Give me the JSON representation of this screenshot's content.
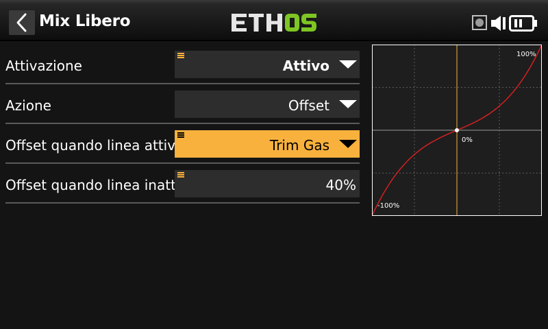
{
  "header": {
    "title": "Mix Libero",
    "logo_text": "ETHOS",
    "logo_colors": {
      "eth": "#e6e6e6",
      "os": "#7ec623"
    },
    "status_icons": [
      "record-indicator-icon",
      "speaker-icon",
      "battery-icon"
    ]
  },
  "rows": [
    {
      "label": "Attivazione",
      "value": "Attivo",
      "has_dropdown": true,
      "selected": false
    },
    {
      "label": "Azione",
      "value": "Offset",
      "has_dropdown": true,
      "selected": false
    },
    {
      "label": "Offset quando linea attiva",
      "value": "Trim Gas",
      "has_dropdown": true,
      "selected": true
    },
    {
      "label": "Offset quando linea inattiva",
      "value": "40%",
      "has_dropdown": false,
      "selected": false
    }
  ],
  "graph": {
    "label_max": "100%",
    "label_center": "0%",
    "label_min": "-100%",
    "colors": {
      "curve": "#d42020",
      "cursor": "#f9b13d",
      "grid": "#5c5c5c",
      "axis": "#9a9a9a",
      "frame": "#ffffff"
    },
    "cursor_input_percent": 0,
    "marker_output_percent": 0
  },
  "theme": {
    "accent": "#f9b13d",
    "field_bg": "#2d2d2d",
    "background": "#141414"
  }
}
